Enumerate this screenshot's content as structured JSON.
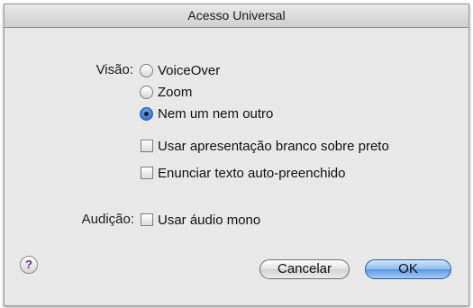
{
  "window": {
    "title": "Acesso Universal"
  },
  "vision": {
    "label": "Visão:",
    "options": [
      {
        "label": "VoiceOver",
        "selected": false
      },
      {
        "label": "Zoom",
        "selected": false
      },
      {
        "label": "Nem um nem outro",
        "selected": true
      }
    ],
    "checkboxes": [
      {
        "label": "Usar apresentação branco sobre preto",
        "checked": false
      },
      {
        "label": "Enunciar texto auto-preenchido",
        "checked": false
      }
    ]
  },
  "hearing": {
    "label": "Audição:",
    "checkbox": {
      "label": "Usar áudio mono",
      "checked": false
    }
  },
  "footer": {
    "help_glyph": "?",
    "cancel_label": "Cancelar",
    "ok_label": "OK"
  },
  "colors": {
    "accent": "#3d7bd1",
    "background": "#e8e8e8"
  }
}
